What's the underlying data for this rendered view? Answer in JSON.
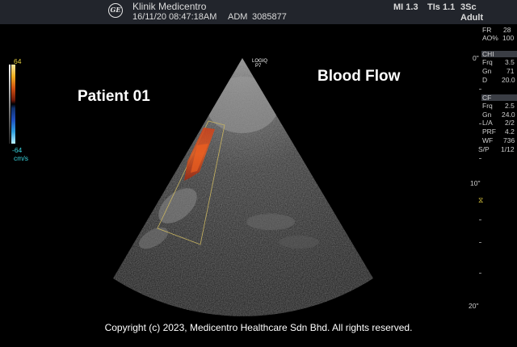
{
  "header": {
    "logo_text": "GE",
    "clinic_name": "Klinik Medicentro",
    "datetime": "16/11/20 08:47:18AM",
    "operator": "ADM",
    "study_id": "3085877",
    "mi": "MI 1.3",
    "tis": "TIs 1.1",
    "probe": "3Sc",
    "preset": "Adult"
  },
  "image": {
    "probe_label_1": "LOGIQ",
    "probe_label_2": "P7",
    "patient_label": "Patient 01",
    "mode_label": "Blood Flow",
    "copyright": "Copyright (c) 2023, Medicentro Healthcare Sdn Bhd. All rights reserved."
  },
  "velocity_scale": {
    "max": "64",
    "min": "-64",
    "unit": "cm/s"
  },
  "depth": {
    "zero": "0\"",
    "mid": "10\"",
    "max": "20\""
  },
  "params": {
    "top": [
      {
        "label": "FR",
        "value": "28"
      },
      {
        "label": "AO%",
        "value": "100"
      }
    ],
    "chi_header": "CHI",
    "chi": [
      {
        "label": "Frq",
        "value": "3.5"
      },
      {
        "label": "Gn",
        "value": "71"
      },
      {
        "label": "D",
        "value": "20.0"
      }
    ],
    "cf_header": "CF",
    "cf": [
      {
        "label": "Frq",
        "value": "2.5"
      },
      {
        "label": "Gn",
        "value": "24.0"
      },
      {
        "label": "L/A",
        "value": "2/2"
      },
      {
        "label": "PRF",
        "value": "4.2"
      },
      {
        "label": "WF",
        "value": "736"
      },
      {
        "label": "S/P",
        "value": "1/12"
      }
    ]
  },
  "colors": {
    "top_bar": "#22252c",
    "accent_yellow": "#e6d040",
    "scale_cyan": "#3ad6e0"
  }
}
